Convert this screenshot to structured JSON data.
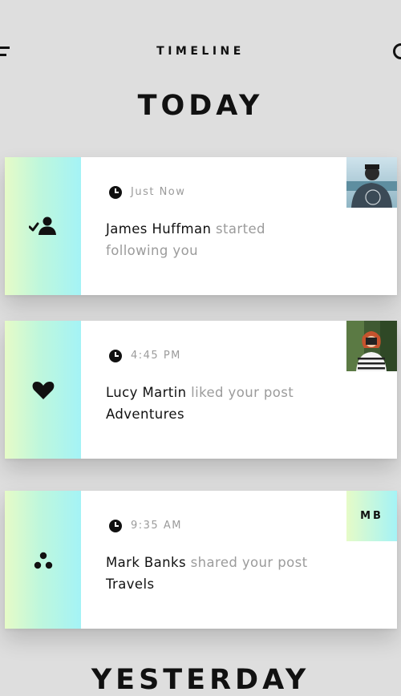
{
  "header": {
    "title": "TIMELINE",
    "menu_icon": "menu-icon",
    "search_icon": "search-icon"
  },
  "sections": [
    {
      "title": "TODAY",
      "items": [
        {
          "type_icon": "follow-icon",
          "time": "Just Now",
          "user": "James Huffman",
          "action": "started following you",
          "target": "",
          "thumbnail": "photo"
        },
        {
          "type_icon": "heart-icon",
          "time": "4:45 PM",
          "user": "Lucy Martin",
          "action": "liked your post",
          "target": "Adventures",
          "thumbnail": "photo"
        },
        {
          "type_icon": "share-icon",
          "time": "9:35 AM",
          "user": "Mark Banks",
          "action": "shared your post",
          "target": "Travels",
          "initials": "MB"
        }
      ]
    },
    {
      "title": "YESTERDAY"
    }
  ],
  "colors": {
    "background": "#dedede",
    "card": "#ffffff",
    "gradient_start": "#e6fbc7",
    "gradient_end": "#a4f3f6",
    "muted_text": "#9b9b9b",
    "text": "#111111"
  }
}
